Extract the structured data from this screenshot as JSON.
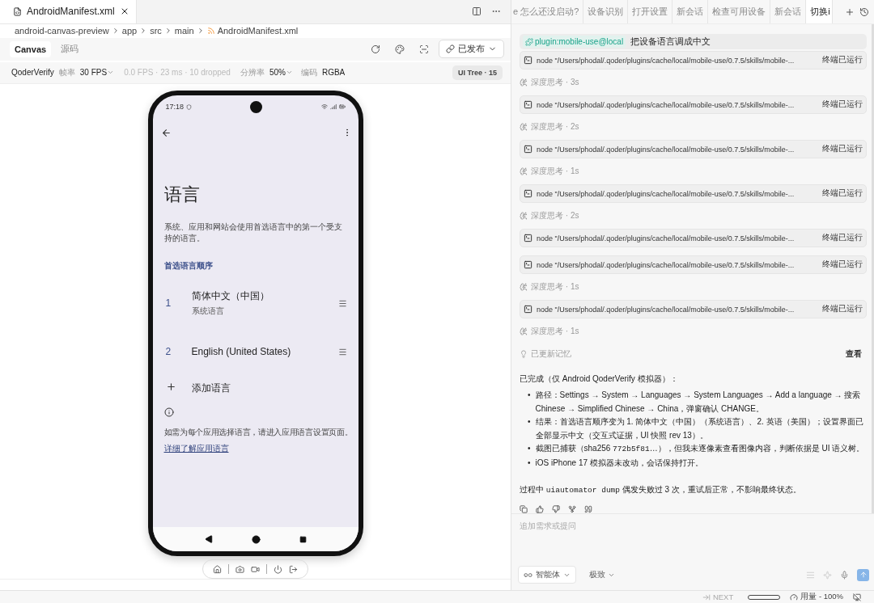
{
  "editor_tab": {
    "title": "AndroidManifest.xml"
  },
  "breadcrumb": [
    "android-canvas-preview",
    "app",
    "src",
    "main",
    "AndroidManifest.xml"
  ],
  "view_tabs": [
    {
      "label": "Canvas",
      "selected": true
    },
    {
      "label": "源码",
      "selected": false
    }
  ],
  "publish_button": "已发布",
  "device_bar": {
    "device": "QoderVerify",
    "fps_label": "帧率",
    "fps": "30 FPS",
    "stats": "0.0 FPS · 23 ms · 10 dropped",
    "resolution_label": "分辨率",
    "resolution": "50%",
    "encoding_label": "编码",
    "encoding": "RGBA",
    "ui_tree": "UI Tree · 15"
  },
  "phone": {
    "time": "17:18",
    "title": "语言",
    "description": "系统、应用和网站会使用首选语言中的第一个受支持的语言。",
    "section": "首选语言顺序",
    "languages": [
      {
        "index": "1",
        "name": "简体中文（中国）",
        "subtitle": "系统语言"
      },
      {
        "index": "2",
        "name": "English (United States)"
      }
    ],
    "add_label": "添加语言",
    "info_text": "如需为每个应用选择语言，请进入应用语言设置页面。",
    "link": "详细了解应用语言"
  },
  "chat_tabs": [
    {
      "label": "e 怎么还没启动?",
      "selected": false
    },
    {
      "label": "设备识别",
      "selected": false
    },
    {
      "label": "打开设置",
      "selected": false
    },
    {
      "label": "新会话",
      "selected": false
    },
    {
      "label": "检查可用设备",
      "selected": false
    },
    {
      "label": "新会话",
      "selected": false
    },
    {
      "label": "切换i",
      "selected": true
    }
  ],
  "chat": {
    "prompt": {
      "plugin": "plugin:mobile-use@local",
      "text": "把设备语言调成中文"
    },
    "steps": [
      {
        "kind": "command",
        "text": "node \"/Users/phodal/.qoder/plugins/cache/local/mobile-use/0.7.5/skills/mobile-...",
        "status": "终端已运行"
      },
      {
        "kind": "thinking",
        "text": "深度思考 · 3s"
      },
      {
        "kind": "command",
        "text": "node \"/Users/phodal/.qoder/plugins/cache/local/mobile-use/0.7.5/skills/mobile-...",
        "status": "终端已运行"
      },
      {
        "kind": "thinking",
        "text": "深度思考 · 2s"
      },
      {
        "kind": "command",
        "text": "node \"/Users/phodal/.qoder/plugins/cache/local/mobile-use/0.7.5/skills/mobile-...",
        "status": "终端已运行"
      },
      {
        "kind": "thinking",
        "text": "深度思考 · 1s"
      },
      {
        "kind": "command",
        "text": "node \"/Users/phodal/.qoder/plugins/cache/local/mobile-use/0.7.5/skills/mobile-...",
        "status": "终端已运行"
      },
      {
        "kind": "thinking",
        "text": "深度思考 · 2s"
      },
      {
        "kind": "command",
        "text": "node \"/Users/phodal/.qoder/plugins/cache/local/mobile-use/0.7.5/skills/mobile-...",
        "status": "终端已运行"
      },
      {
        "kind": "command",
        "text": "node \"/Users/phodal/.qoder/plugins/cache/local/mobile-use/0.7.5/skills/mobile-...",
        "status": "终端已运行"
      },
      {
        "kind": "thinking",
        "text": "深度思考 · 1s"
      },
      {
        "kind": "command",
        "text": "node \"/Users/phodal/.qoder/plugins/cache/local/mobile-use/0.7.5/skills/mobile-...",
        "status": "终端已运行"
      },
      {
        "kind": "thinking",
        "text": "深度思考 · 1s"
      }
    ],
    "memory": {
      "label": "已更新记忆",
      "action": "查看"
    },
    "answer": {
      "intro": "已完成（仅 Android QoderVerify 模拟器）：",
      "bullets": [
        {
          "marker": "•",
          "parts": [
            {
              "kind": "text",
              "text": "路径：Settings → System → Languages → System Languages → Add a language → 搜索 Chinese → Simplified Chinese → China，弹窗确认 CHANGE。"
            }
          ]
        },
        {
          "marker": "•",
          "parts": [
            {
              "kind": "text",
              "text": "结果：首选语言顺序变为 1. 简体中文（中国）（系统语言）、2. 英语（美国）；设置界面已全部显示中文（交互式证据，UI 快照 rev 13）。"
            }
          ]
        },
        {
          "marker": "•",
          "parts": [
            {
              "kind": "text",
              "text": "截图已捕获（sha256 "
            },
            {
              "kind": "code",
              "text": "772b5f81"
            },
            {
              "kind": "text",
              "text": "…），但我未逐像素查看图像内容，判断依据是 UI 语义树。"
            }
          ]
        },
        {
          "marker": "•",
          "parts": [
            {
              "kind": "text",
              "text": "iOS iPhone 17 模拟器未改动，会话保持打开。"
            }
          ]
        }
      ],
      "footer": [
        {
          "kind": "text",
          "text": "过程中 "
        },
        {
          "kind": "code",
          "text": "uiautomator dump"
        },
        {
          "kind": "text",
          "text": " 偶发失败过 3 次，重试后正常，不影响最终状态。"
        }
      ]
    }
  },
  "input": {
    "placeholder": "追加需求或提问",
    "mode": "智能体",
    "level": "极致"
  },
  "status_bar": {
    "next": "NEXT",
    "usage": "用量 - 100%"
  }
}
